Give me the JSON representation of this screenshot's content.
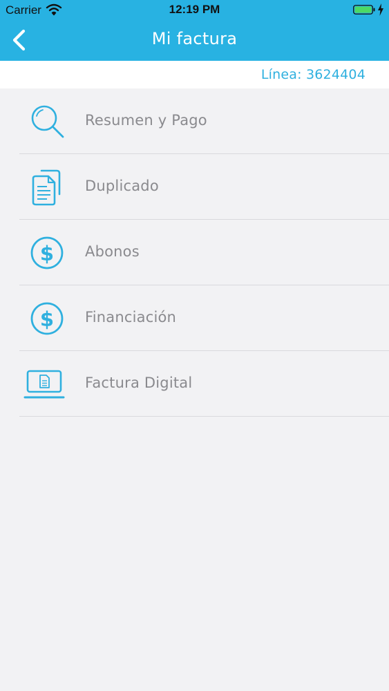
{
  "status_bar": {
    "carrier": "Carrier",
    "time": "12:19 PM"
  },
  "nav": {
    "title": "Mi factura"
  },
  "line": {
    "label": "Línea: 3624404"
  },
  "menu": {
    "items": [
      {
        "label": "Resumen y Pago",
        "icon": "search-icon"
      },
      {
        "label": "Duplicado",
        "icon": "document-icon"
      },
      {
        "label": "Abonos",
        "icon": "dollar-icon"
      },
      {
        "label": "Financiación",
        "icon": "dollar-icon"
      },
      {
        "label": "Factura Digital",
        "icon": "laptop-document-icon"
      }
    ]
  },
  "colors": {
    "accent": "#28b2e2",
    "icon": "#2fb0df",
    "label": "#8a8a8e",
    "background": "#f2f2f4"
  }
}
